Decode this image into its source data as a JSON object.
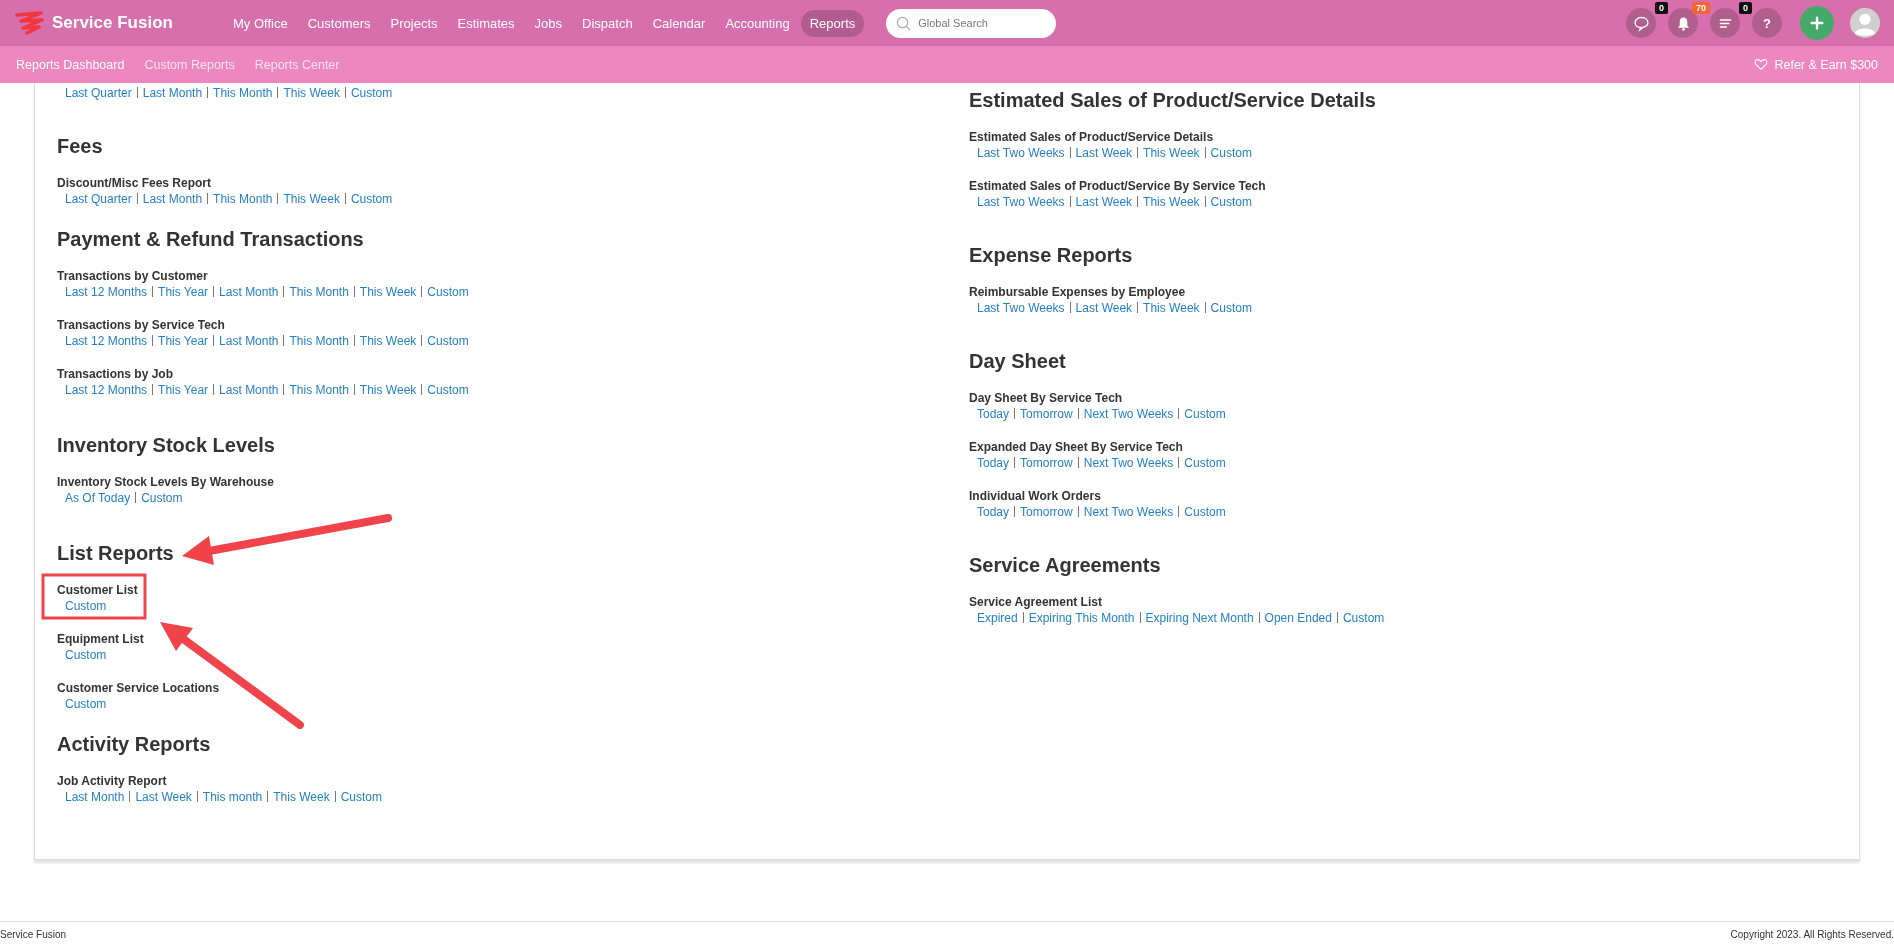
{
  "brand": "Service Fusion",
  "nav": [
    {
      "label": "My Office",
      "selected": false
    },
    {
      "label": "Customers",
      "selected": false
    },
    {
      "label": "Projects",
      "selected": false
    },
    {
      "label": "Estimates",
      "selected": false
    },
    {
      "label": "Jobs",
      "selected": false
    },
    {
      "label": "Dispatch",
      "selected": false
    },
    {
      "label": "Calendar",
      "selected": false
    },
    {
      "label": "Accounting",
      "selected": false
    },
    {
      "label": "Reports",
      "selected": true
    }
  ],
  "search": {
    "placeholder": "Global Search"
  },
  "toolbar": [
    {
      "kind": "chat",
      "badge": "0",
      "color": "#111111"
    },
    {
      "kind": "bell",
      "badge": "70",
      "color": "#f26530"
    },
    {
      "kind": "list",
      "badge": "0",
      "color": "#111111"
    },
    {
      "kind": "help",
      "symbol": "?"
    }
  ],
  "subnav": [
    {
      "label": "Reports Dashboard",
      "selected": true
    },
    {
      "label": "Custom Reports",
      "selected": false
    },
    {
      "label": "Reports Center",
      "selected": false
    }
  ],
  "refer": "Refer & Earn $300",
  "columns": [
    [
      {
        "reports": [
          {
            "links": [
              "Last Quarter",
              "Last Month",
              "This Month",
              "This Week",
              "Custom"
            ]
          }
        ]
      },
      {
        "title": "Fees",
        "reports": [
          {
            "name": "Discount/Misc Fees Report",
            "links": [
              "Last Quarter",
              "Last Month",
              "This Month",
              "This Week",
              "Custom"
            ]
          }
        ]
      },
      {
        "title": "Payment & Refund Transactions",
        "reports": [
          {
            "name": "Transactions by Customer",
            "links": [
              "Last 12 Months",
              "This Year",
              "Last Month",
              "This Month",
              "This Week",
              "Custom"
            ]
          },
          {
            "name": "Transactions by Service Tech",
            "links": [
              "Last 12 Months",
              "This Year",
              "Last Month",
              "This Month",
              "This Week",
              "Custom"
            ]
          },
          {
            "name": "Transactions by Job",
            "links": [
              "Last 12 Months",
              "This Year",
              "Last Month",
              "This Month",
              "This Week",
              "Custom"
            ]
          }
        ]
      },
      {
        "title": "Inventory Stock Levels",
        "reports": [
          {
            "name": "Inventory Stock Levels By Warehouse",
            "links": [
              "As Of Today",
              "Custom"
            ]
          }
        ]
      },
      {
        "title": "List Reports",
        "reports": [
          {
            "name": "Customer List",
            "links": [
              "Custom"
            ]
          },
          {
            "name": "Equipment List",
            "links": [
              "Custom"
            ]
          },
          {
            "name": "Customer Service Locations",
            "links": [
              "Custom"
            ]
          }
        ]
      },
      {
        "title": "Activity Reports",
        "reports": [
          {
            "name": "Job Activity Report",
            "links": [
              "Last Month",
              "Last Week",
              "This month",
              "This Week",
              "Custom"
            ]
          }
        ]
      }
    ],
    [
      {
        "title": "Estimated Sales of Product/Service Details",
        "reports": [
          {
            "name": "Estimated Sales of Product/Service Details",
            "links": [
              "Last Two Weeks",
              "Last Week",
              "This Week",
              "Custom"
            ]
          },
          {
            "name": "Estimated Sales of Product/Service By Service Tech",
            "links": [
              "Last Two Weeks",
              "Last Week",
              "This Week",
              "Custom"
            ]
          }
        ]
      },
      {
        "title": "Expense Reports",
        "reports": [
          {
            "name": "Reimbursable Expenses by Employee",
            "links": [
              "Last Two Weeks",
              "Last Week",
              "This Week",
              "Custom"
            ]
          }
        ]
      },
      {
        "title": "Day Sheet",
        "reports": [
          {
            "name": "Day Sheet By Service Tech",
            "links": [
              "Today",
              "Tomorrow",
              "Next Two Weeks",
              "Custom"
            ]
          },
          {
            "name": "Expanded Day Sheet By Service Tech",
            "links": [
              "Today",
              "Tomorrow",
              "Next Two Weeks",
              "Custom"
            ]
          },
          {
            "name": "Individual Work Orders",
            "links": [
              "Today",
              "Tomorrow",
              "Next Two Weeks",
              "Custom"
            ]
          }
        ]
      },
      {
        "title": "Service Agreements",
        "reports": [
          {
            "name": "Service Agreement List",
            "links": [
              "Expired",
              "Expiring This Month",
              "Expiring Next Month",
              "Open Ended",
              "Custom"
            ]
          }
        ]
      }
    ]
  ],
  "footer": {
    "left": "Service Fusion",
    "right": "Copyright 2023. All Rights Reserved."
  }
}
